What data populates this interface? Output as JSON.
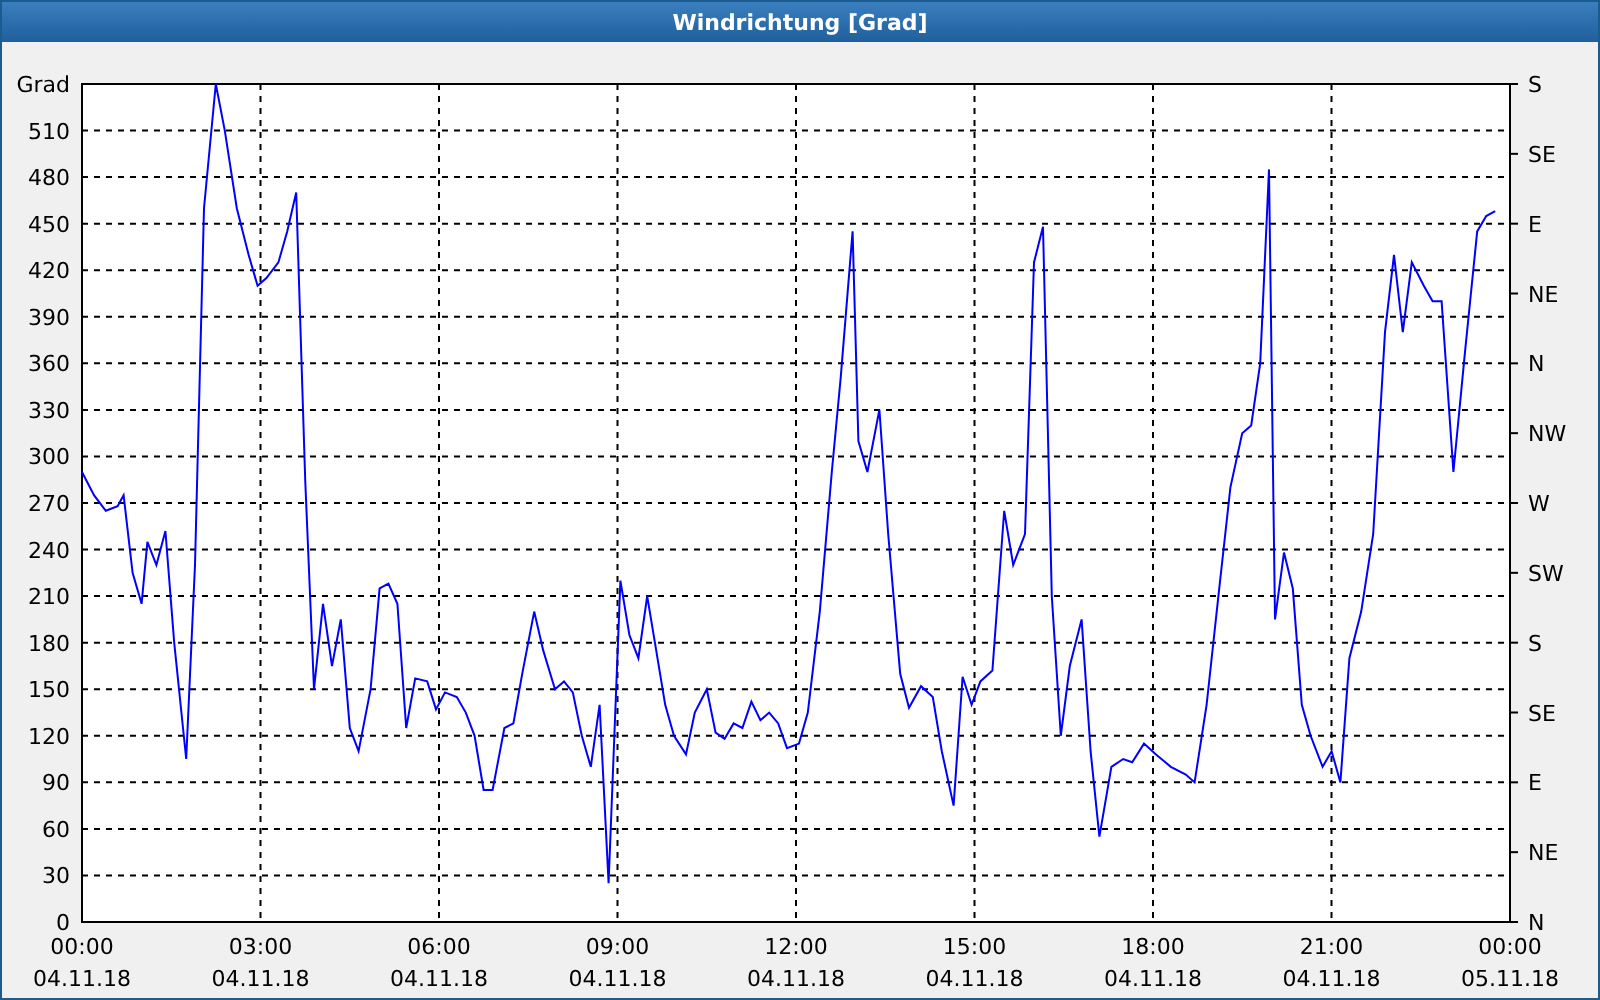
{
  "window": {
    "title": "Windrichtung [Grad]"
  },
  "chart": {
    "chart_data": {
      "type": "line",
      "grid": true,
      "ylabel": "Grad",
      "xlim": [
        0,
        24
      ],
      "ylim": [
        0,
        540
      ],
      "xticks": [
        {
          "value": 0,
          "label": "00:00"
        },
        {
          "value": 3,
          "label": "03:00"
        },
        {
          "value": 6,
          "label": "06:00"
        },
        {
          "value": 9,
          "label": "09:00"
        },
        {
          "value": 12,
          "label": "12:00"
        },
        {
          "value": 15,
          "label": "15:00"
        },
        {
          "value": 18,
          "label": "18:00"
        },
        {
          "value": 21,
          "label": "21:00"
        },
        {
          "value": 24,
          "label": "00:00"
        }
      ],
      "yticks": [
        0,
        30,
        60,
        90,
        120,
        150,
        180,
        210,
        240,
        270,
        300,
        330,
        360,
        390,
        420,
        450,
        480,
        510
      ],
      "x": [
        0,
        0.2,
        0.4,
        0.6,
        0.7,
        0.85,
        1,
        1.1,
        1.25,
        1.4,
        1.55,
        1.75,
        1.9,
        2.05,
        2.25,
        2.4,
        2.6,
        2.8,
        2.95,
        3.1,
        3.3,
        3.45,
        3.6,
        3.75,
        3.9,
        4.05,
        4.2,
        4.35,
        4.5,
        4.65,
        4.85,
        5,
        5.15,
        5.3,
        5.45,
        5.6,
        5.8,
        5.95,
        6.1,
        6.3,
        6.45,
        6.6,
        6.75,
        6.9,
        7.1,
        7.25,
        7.4,
        7.6,
        7.75,
        7.95,
        8.1,
        8.25,
        8.4,
        8.55,
        8.7,
        8.85,
        9.05,
        9.2,
        9.35,
        9.5,
        9.65,
        9.8,
        9.95,
        10.15,
        10.3,
        10.5,
        10.65,
        10.8,
        10.95,
        11.1,
        11.25,
        11.4,
        11.55,
        11.7,
        11.85,
        12.05,
        12.2,
        12.4,
        12.6,
        12.75,
        12.95,
        13.05,
        13.2,
        13.4,
        13.55,
        13.75,
        13.9,
        14.1,
        14.3,
        14.45,
        14.65,
        14.8,
        14.95,
        15.1,
        15.3,
        15.5,
        15.65,
        15.85,
        16,
        16.15,
        16.3,
        16.45,
        16.6,
        16.8,
        16.95,
        17.1,
        17.3,
        17.5,
        17.65,
        17.85,
        18.05,
        18.3,
        18.55,
        18.7,
        18.9,
        19.1,
        19.3,
        19.5,
        19.65,
        19.8,
        19.95,
        20.05,
        20.2,
        20.35,
        20.5,
        20.65,
        20.85,
        21,
        21.15,
        21.3,
        21.5,
        21.7,
        21.9,
        22.05,
        22.2,
        22.35,
        22.55,
        22.7,
        22.85,
        23.05,
        23.25,
        23.45,
        23.6,
        23.75
      ],
      "series": [
        {
          "color": "#0000ff",
          "values": [
            290,
            275,
            265,
            268,
            275,
            225,
            205,
            245,
            230,
            252,
            180,
            105,
            230,
            460,
            540,
            510,
            460,
            430,
            410,
            415,
            425,
            445,
            470,
            285,
            150,
            205,
            165,
            195,
            125,
            110,
            150,
            215,
            218,
            205,
            125,
            157,
            155,
            137,
            148,
            145,
            135,
            120,
            85,
            85,
            125,
            128,
            160,
            200,
            175,
            150,
            155,
            148,
            120,
            100,
            140,
            25,
            220,
            185,
            170,
            210,
            175,
            140,
            120,
            108,
            135,
            150,
            122,
            118,
            128,
            125,
            142,
            130,
            135,
            128,
            112,
            115,
            135,
            200,
            290,
            350,
            445,
            310,
            290,
            330,
            250,
            160,
            138,
            152,
            145,
            110,
            75,
            158,
            140,
            155,
            162,
            265,
            230,
            250,
            425,
            448,
            210,
            120,
            165,
            195,
            110,
            55,
            100,
            105,
            103,
            115,
            108,
            100,
            95,
            90,
            140,
            210,
            280,
            315,
            320,
            360,
            485,
            195,
            238,
            215,
            140,
            120,
            100,
            110,
            90,
            170,
            200,
            250,
            380,
            430,
            380,
            425,
            410,
            400,
            400,
            290,
            370,
            445,
            455,
            458
          ]
        }
      ]
    },
    "x_dates": [
      "04.11.18",
      "04.11.18",
      "04.11.18",
      "04.11.18",
      "04.11.18",
      "04.11.18",
      "04.11.18",
      "04.11.18",
      "05.11.18"
    ],
    "compass_labels": [
      "S",
      "SE",
      "E",
      "NE",
      "N",
      "NW",
      "W",
      "SW",
      "S",
      "SE",
      "E",
      "NE",
      "N"
    ]
  }
}
